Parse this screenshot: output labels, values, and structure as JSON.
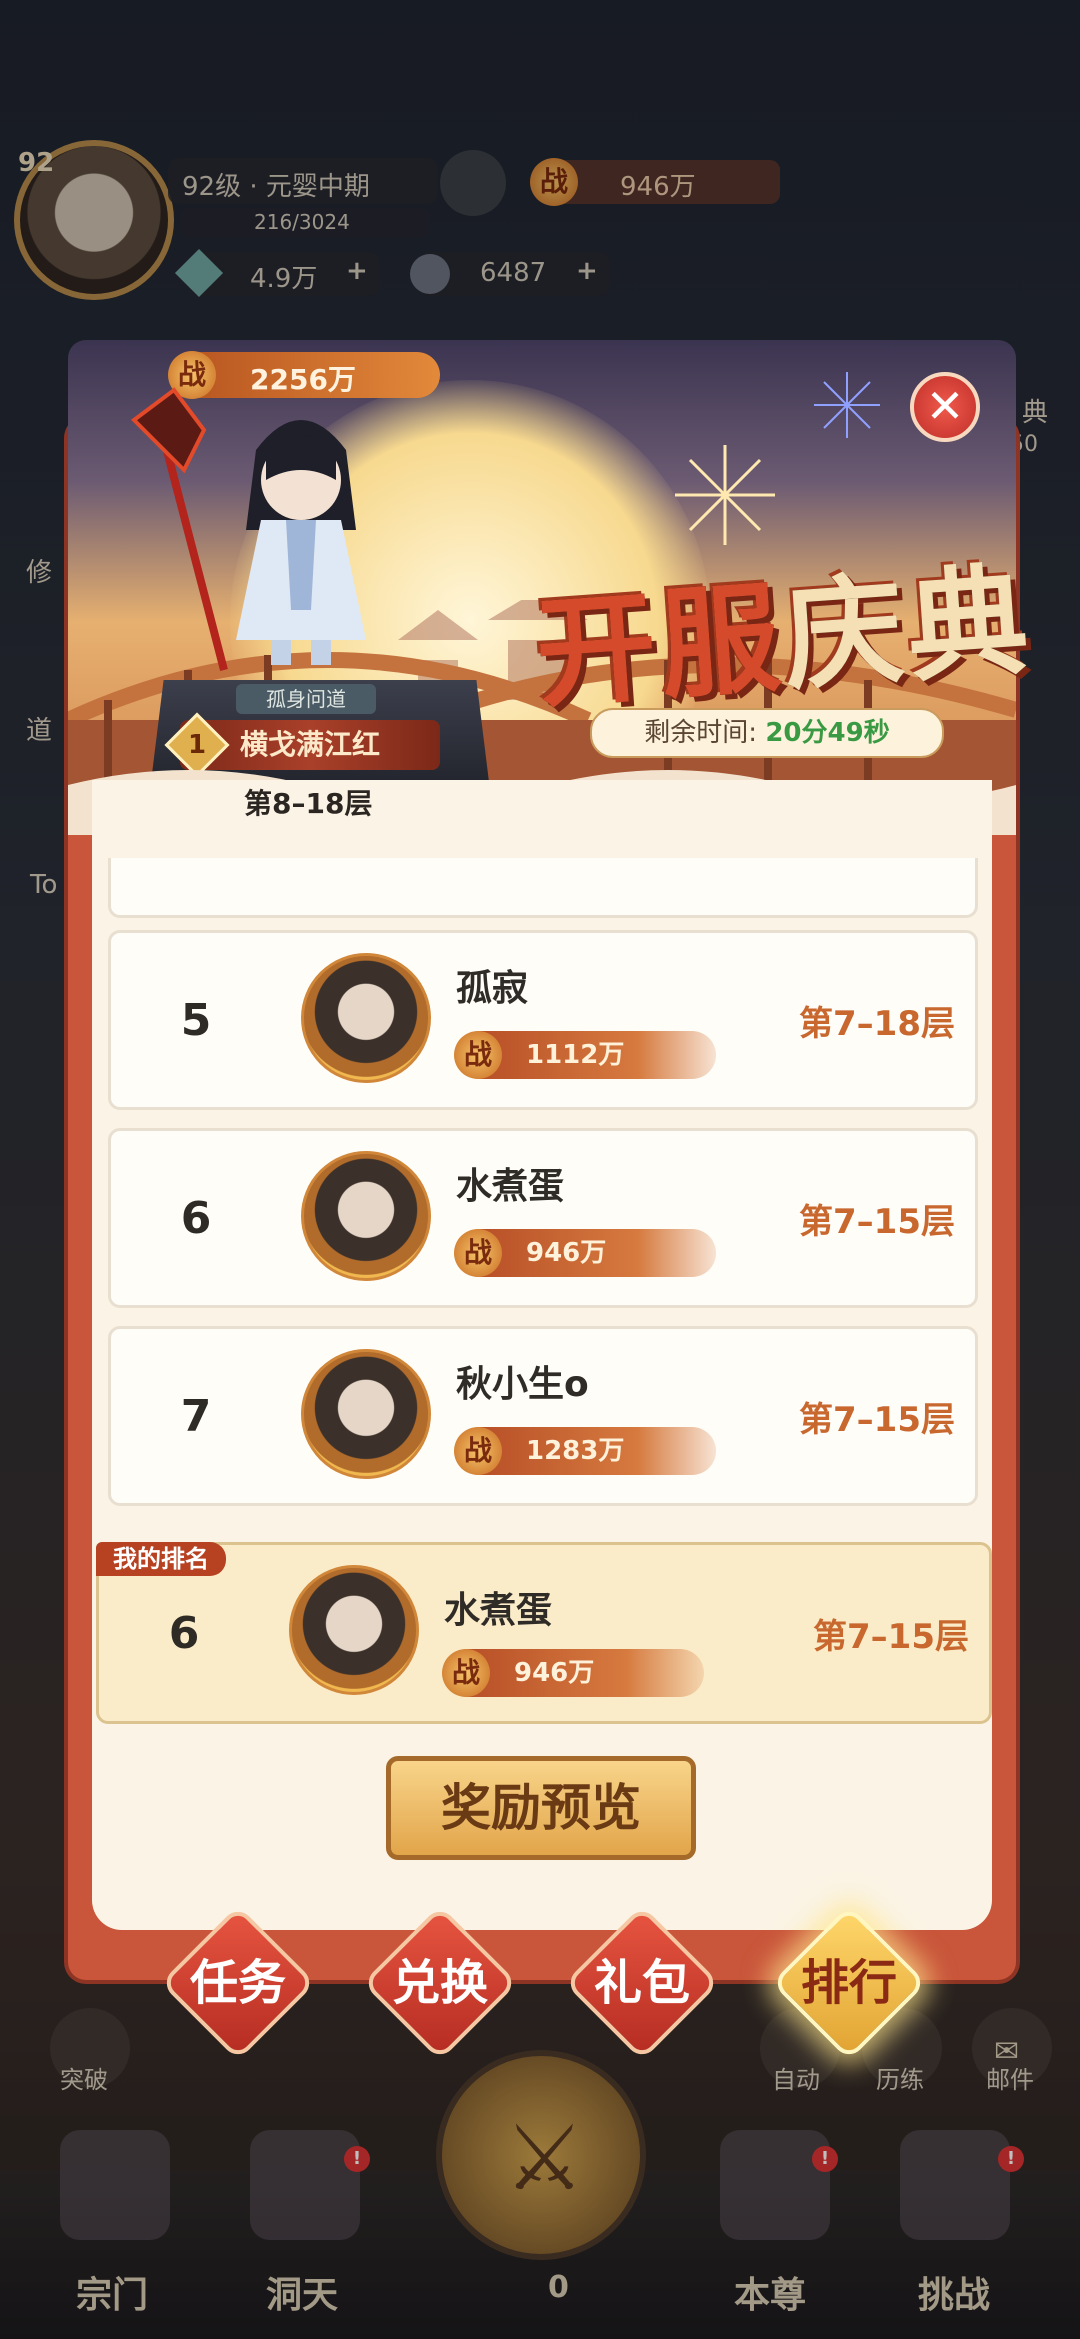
{
  "hud": {
    "level": "92",
    "realm": "92级 · 元婴中期",
    "exp": "216/3024",
    "power": "946万",
    "power_icon": "战",
    "gem": "4.9万",
    "coin": "6487",
    "plus": "+"
  },
  "side_left": [
    "修",
    "道",
    "To"
  ],
  "side_right": [
    "典",
    "50"
  ],
  "bottom_nav": {
    "breakthrough": "突破",
    "auto": "自动",
    "training": "历练",
    "mail": "邮件",
    "items": [
      "宗门",
      "洞天",
      "本尊",
      "挑战"
    ],
    "center_count": "0",
    "badge": "!"
  },
  "event": {
    "title_a": "开服",
    "title_b": "庆典",
    "close": "✕",
    "remaining_label": "剩余时间:",
    "remaining_value": "20分49秒",
    "top_player": {
      "power": "2256万",
      "route": "孤身问道",
      "rank": "1",
      "name": "横戈满江红",
      "floor": "第8–18层"
    }
  },
  "ranking": [
    {
      "rank": "5",
      "name": "孤寂",
      "power": "1112万",
      "floor": "第7–18层"
    },
    {
      "rank": "6",
      "name": "水煮蛋",
      "power": "946万",
      "floor": "第7–15层"
    },
    {
      "rank": "7",
      "name": "秋小生o",
      "power": "1283万",
      "floor": "第7–15层"
    }
  ],
  "my_rank": {
    "tag": "我的排名",
    "rank": "6",
    "name": "水煮蛋",
    "power": "946万",
    "floor": "第7–15层"
  },
  "reward_button": "奖励预览",
  "tabs": [
    "任务",
    "兑换",
    "礼包",
    "排行"
  ],
  "colors": {
    "accent": "#c9553a",
    "gold": "#e2a54a",
    "timer_green": "#3a9a44"
  }
}
